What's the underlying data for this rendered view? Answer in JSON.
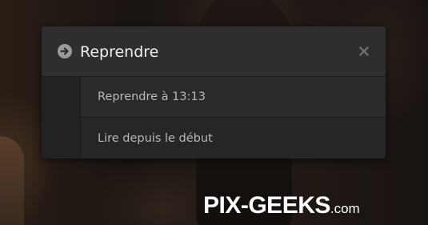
{
  "dialog": {
    "title": "Reprendre",
    "header_icon": "arrow-right-circle-icon",
    "close_icon": "close-icon",
    "options": [
      {
        "label": "Reprendre à 13:13"
      },
      {
        "label": "Lire depuis le début"
      }
    ]
  },
  "watermark": {
    "main": "PIX-GEEKS",
    "suffix": ".com"
  },
  "colors": {
    "dialog_background": "#262626",
    "header_background": "#2e2e2e",
    "title_text": "#eeeeee",
    "option_text": "#b8b8b8",
    "icon": "#9a9a9a"
  }
}
